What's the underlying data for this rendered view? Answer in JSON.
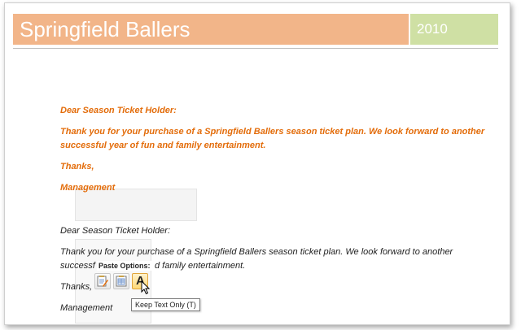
{
  "header": {
    "title": "Springfield Ballers",
    "year": "2010",
    "colors": {
      "title_bg": "#f2b589",
      "year_bg": "#cfe0a4",
      "text_orange": "#e36c0a"
    }
  },
  "letter_formatted": {
    "greeting": "Dear Season Ticket Holder:",
    "body_line1": "Thank you for your purchase of a Springfield Ballers season ticket plan. We look forward to another",
    "body_line2": "successful  year of fun and family entertainment.",
    "closing": "Thanks,",
    "signature": "Management"
  },
  "letter_plain": {
    "greeting": "Dear Season Ticket Holder:",
    "body_line1": "Thank you for your purchase of a Springfield Ballers season ticket plan. We look forward to another",
    "body_line2_start": "successf",
    "body_line2_end": "d family entertainment.",
    "closing": "Thanks,",
    "signature": "Management"
  },
  "paste_options": {
    "label": "Paste Options:",
    "buttons": [
      {
        "name": "keep-source-formatting-icon"
      },
      {
        "name": "merge-formatting-icon"
      },
      {
        "name": "keep-text-only-icon",
        "glyph": "A",
        "selected": true
      }
    ],
    "tooltip": "Keep Text Only (T)"
  }
}
